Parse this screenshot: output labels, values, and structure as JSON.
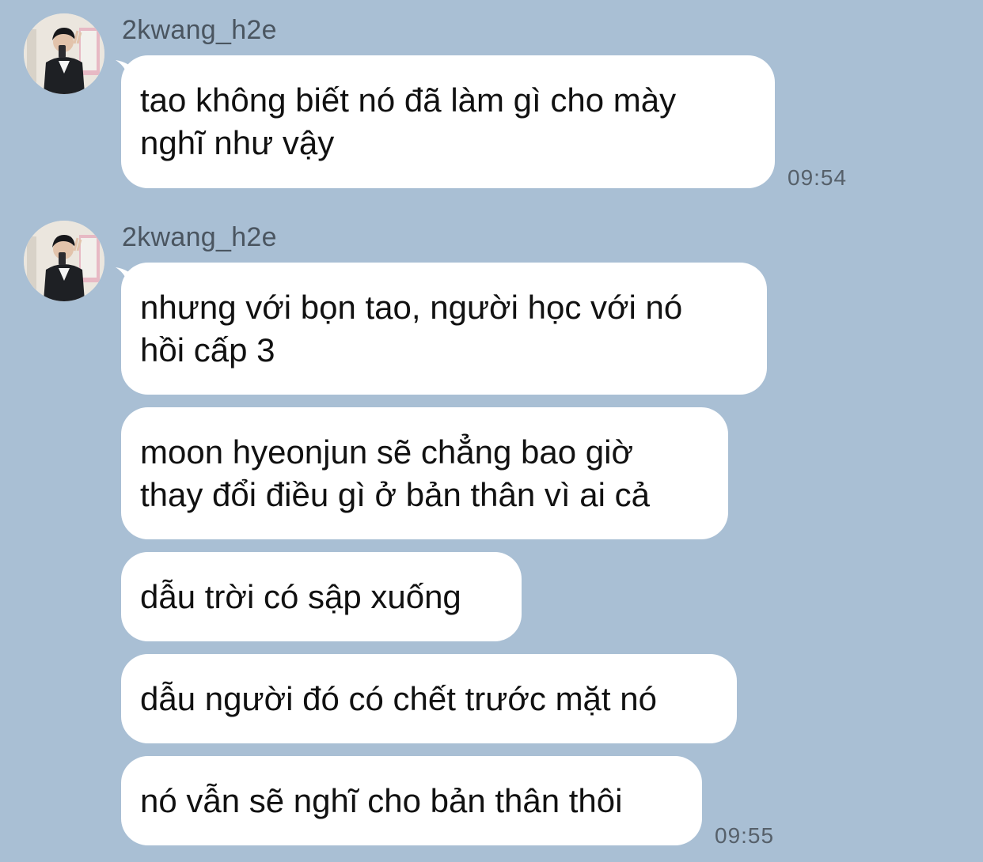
{
  "colors": {
    "background": "#a9bfd4",
    "bubble": "#ffffff",
    "sender_text": "#4a5560",
    "time_text": "#56606a"
  },
  "groups": [
    {
      "sender": "2kwang_h2e",
      "avatar_icon": "profile-photo-avatar",
      "messages": [
        "tao không biết nó đã làm gì cho mày\nnghĩ như vậy"
      ],
      "time": "09:54"
    },
    {
      "sender": "2kwang_h2e",
      "avatar_icon": "profile-photo-avatar",
      "messages": [
        "nhưng với bọn tao, người học với nó\nhồi cấp 3",
        "moon hyeonjun sẽ chẳng bao giờ\nthay đổi điều gì ở bản thân vì ai cả",
        "dẫu trời có sập xuống",
        "dẫu người đó có chết trước mặt nó",
        "nó vẫn sẽ nghĩ cho bản thân thôi"
      ],
      "time": "09:55"
    }
  ]
}
